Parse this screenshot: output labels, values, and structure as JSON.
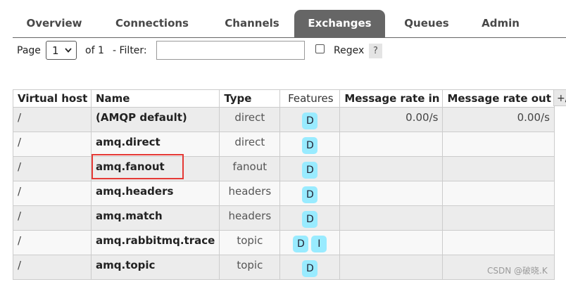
{
  "nav": {
    "tabs": [
      {
        "label": "Overview",
        "active": false
      },
      {
        "label": "Connections",
        "active": false
      },
      {
        "label": "Channels",
        "active": false
      },
      {
        "label": "Exchanges",
        "active": true
      },
      {
        "label": "Queues",
        "active": false
      },
      {
        "label": "Admin",
        "active": false
      }
    ]
  },
  "paging": {
    "page_label": "Page",
    "page_value": "1",
    "of_label": "of 1",
    "filter_label": "- Filter:",
    "filter_value": "",
    "regex_label": "Regex",
    "regex_checked": false,
    "help_label": "?"
  },
  "table": {
    "headers": {
      "virtual_host": "Virtual host",
      "name": "Name",
      "type": "Type",
      "features": "Features",
      "rate_in": "Message rate in",
      "rate_out": "Message rate out",
      "add_remove": "+/-"
    },
    "rows": [
      {
        "vhost": "/",
        "name": "(AMQP default)",
        "type": "direct",
        "features": [
          "D"
        ],
        "rate_in": "0.00/s",
        "rate_out": "0.00/s"
      },
      {
        "vhost": "/",
        "name": "amq.direct",
        "type": "direct",
        "features": [
          "D"
        ],
        "rate_in": "",
        "rate_out": ""
      },
      {
        "vhost": "/",
        "name": "amq.fanout",
        "type": "fanout",
        "features": [
          "D"
        ],
        "rate_in": "",
        "rate_out": ""
      },
      {
        "vhost": "/",
        "name": "amq.headers",
        "type": "headers",
        "features": [
          "D"
        ],
        "rate_in": "",
        "rate_out": ""
      },
      {
        "vhost": "/",
        "name": "amq.match",
        "type": "headers",
        "features": [
          "D"
        ],
        "rate_in": "",
        "rate_out": ""
      },
      {
        "vhost": "/",
        "name": "amq.rabbitmq.trace",
        "type": "topic",
        "features": [
          "D",
          "I"
        ],
        "rate_in": "",
        "rate_out": ""
      },
      {
        "vhost": "/",
        "name": "amq.topic",
        "type": "topic",
        "features": [
          "D"
        ],
        "rate_in": "",
        "rate_out": ""
      }
    ]
  },
  "colors": {
    "active_tab_bg": "#666666",
    "feature_badge_bg": "#99ebff",
    "highlight_border": "#e53935",
    "row_odd_bg": "#ececec",
    "row_even_bg": "#f8f8f8"
  },
  "watermark": "CSDN @破晓.K"
}
